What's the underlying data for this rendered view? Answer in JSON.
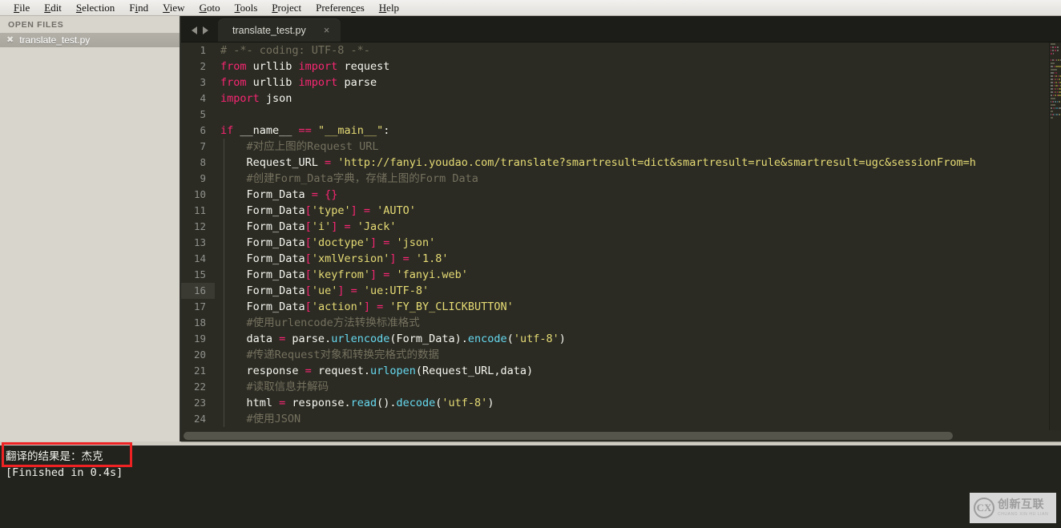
{
  "menubar": {
    "items": [
      {
        "label": "File",
        "acc_index": 0
      },
      {
        "label": "Edit",
        "acc_index": 0
      },
      {
        "label": "Selection",
        "acc_index": 0
      },
      {
        "label": "Find",
        "acc_index": 1
      },
      {
        "label": "View",
        "acc_index": 0
      },
      {
        "label": "Goto",
        "acc_index": 0
      },
      {
        "label": "Tools",
        "acc_index": 0
      },
      {
        "label": "Project",
        "acc_index": 0
      },
      {
        "label": "Preferences",
        "acc_index": 8
      },
      {
        "label": "Help",
        "acc_index": 0
      }
    ]
  },
  "sidebar": {
    "header": "OPEN FILES",
    "close_glyph": "✖",
    "files": [
      {
        "name": "translate_test.py",
        "selected": true
      }
    ]
  },
  "tabbar": {
    "nav_back": "◀",
    "nav_forward": "▶",
    "tabs": [
      {
        "label": "translate_test.py",
        "close": "×",
        "active": true
      }
    ]
  },
  "editor": {
    "active_line": 16,
    "lines": [
      {
        "num": "1",
        "indent": false,
        "tokens": [
          {
            "t": "com",
            "s": "# -*- coding: UTF-8 -*-"
          }
        ]
      },
      {
        "num": "2",
        "indent": false,
        "tokens": [
          {
            "t": "kw",
            "s": "from"
          },
          {
            "t": "id",
            "s": " urllib "
          },
          {
            "t": "kw",
            "s": "import"
          },
          {
            "t": "id",
            "s": " request"
          }
        ]
      },
      {
        "num": "3",
        "indent": false,
        "tokens": [
          {
            "t": "kw",
            "s": "from"
          },
          {
            "t": "id",
            "s": " urllib "
          },
          {
            "t": "kw",
            "s": "import"
          },
          {
            "t": "id",
            "s": " parse"
          }
        ]
      },
      {
        "num": "4",
        "indent": false,
        "tokens": [
          {
            "t": "kw",
            "s": "import"
          },
          {
            "t": "id",
            "s": " json"
          }
        ]
      },
      {
        "num": "5",
        "indent": false,
        "tokens": []
      },
      {
        "num": "6",
        "indent": false,
        "tokens": [
          {
            "t": "kw",
            "s": "if"
          },
          {
            "t": "id",
            "s": " __name__ "
          },
          {
            "t": "op",
            "s": "=="
          },
          {
            "t": "id",
            "s": " "
          },
          {
            "t": "str",
            "s": "\"__main__\""
          },
          {
            "t": "id",
            "s": ":"
          }
        ]
      },
      {
        "num": "7",
        "indent": true,
        "tokens": [
          {
            "t": "com",
            "s": "    #对应上图的Request URL"
          }
        ]
      },
      {
        "num": "8",
        "indent": true,
        "tokens": [
          {
            "t": "id",
            "s": "    Request_URL "
          },
          {
            "t": "op",
            "s": "="
          },
          {
            "t": "str",
            "s": " 'http://fanyi.youdao.com/translate?smartresult=dict&smartresult=rule&smartresult=ugc&sessionFrom=h"
          }
        ]
      },
      {
        "num": "9",
        "indent": true,
        "tokens": [
          {
            "t": "com",
            "s": "    #创建Form_Data字典，存储上图的Form Data"
          }
        ]
      },
      {
        "num": "10",
        "indent": true,
        "tokens": [
          {
            "t": "id",
            "s": "    Form_Data "
          },
          {
            "t": "op",
            "s": "="
          },
          {
            "t": "op",
            "s": " {}"
          }
        ]
      },
      {
        "num": "11",
        "indent": true,
        "tokens": [
          {
            "t": "id",
            "s": "    Form_Data"
          },
          {
            "t": "op",
            "s": "["
          },
          {
            "t": "str",
            "s": "'type'"
          },
          {
            "t": "op",
            "s": "] = "
          },
          {
            "t": "str",
            "s": "'AUTO'"
          }
        ]
      },
      {
        "num": "12",
        "indent": true,
        "tokens": [
          {
            "t": "id",
            "s": "    Form_Data"
          },
          {
            "t": "op",
            "s": "["
          },
          {
            "t": "str",
            "s": "'i'"
          },
          {
            "t": "op",
            "s": "] = "
          },
          {
            "t": "str",
            "s": "'Jack'"
          }
        ]
      },
      {
        "num": "13",
        "indent": true,
        "tokens": [
          {
            "t": "id",
            "s": "    Form_Data"
          },
          {
            "t": "op",
            "s": "["
          },
          {
            "t": "str",
            "s": "'doctype'"
          },
          {
            "t": "op",
            "s": "] = "
          },
          {
            "t": "str",
            "s": "'json'"
          }
        ]
      },
      {
        "num": "14",
        "indent": true,
        "tokens": [
          {
            "t": "id",
            "s": "    Form_Data"
          },
          {
            "t": "op",
            "s": "["
          },
          {
            "t": "str",
            "s": "'xmlVersion'"
          },
          {
            "t": "op",
            "s": "] = "
          },
          {
            "t": "str",
            "s": "'1.8'"
          }
        ]
      },
      {
        "num": "15",
        "indent": true,
        "tokens": [
          {
            "t": "id",
            "s": "    Form_Data"
          },
          {
            "t": "op",
            "s": "["
          },
          {
            "t": "str",
            "s": "'keyfrom'"
          },
          {
            "t": "op",
            "s": "] = "
          },
          {
            "t": "str",
            "s": "'fanyi.web'"
          }
        ]
      },
      {
        "num": "16",
        "indent": true,
        "tokens": [
          {
            "t": "id",
            "s": "    Form_Data"
          },
          {
            "t": "op",
            "s": "["
          },
          {
            "t": "str",
            "s": "'ue'"
          },
          {
            "t": "op",
            "s": "] = "
          },
          {
            "t": "str",
            "s": "'ue:UTF-8'"
          }
        ]
      },
      {
        "num": "17",
        "indent": true,
        "tokens": [
          {
            "t": "id",
            "s": "    Form_Data"
          },
          {
            "t": "op",
            "s": "["
          },
          {
            "t": "str",
            "s": "'action'"
          },
          {
            "t": "op",
            "s": "] = "
          },
          {
            "t": "str",
            "s": "'FY_BY_CLICKBUTTON'"
          }
        ]
      },
      {
        "num": "18",
        "indent": true,
        "tokens": [
          {
            "t": "com",
            "s": "    #使用urlencode方法转换标准格式"
          }
        ]
      },
      {
        "num": "19",
        "indent": true,
        "tokens": [
          {
            "t": "id",
            "s": "    data "
          },
          {
            "t": "op",
            "s": "="
          },
          {
            "t": "id",
            "s": " parse."
          },
          {
            "t": "fn",
            "s": "urlencode"
          },
          {
            "t": "id",
            "s": "(Form_Data)."
          },
          {
            "t": "fn",
            "s": "encode"
          },
          {
            "t": "id",
            "s": "("
          },
          {
            "t": "str",
            "s": "'utf-8'"
          },
          {
            "t": "id",
            "s": ")"
          }
        ]
      },
      {
        "num": "20",
        "indent": true,
        "tokens": [
          {
            "t": "com",
            "s": "    #传递Request对象和转换完格式的数据"
          }
        ]
      },
      {
        "num": "21",
        "indent": true,
        "tokens": [
          {
            "t": "id",
            "s": "    response "
          },
          {
            "t": "op",
            "s": "="
          },
          {
            "t": "id",
            "s": " request."
          },
          {
            "t": "fn",
            "s": "urlopen"
          },
          {
            "t": "id",
            "s": "(Request_URL,data)"
          }
        ]
      },
      {
        "num": "22",
        "indent": true,
        "tokens": [
          {
            "t": "com",
            "s": "    #读取信息并解码"
          }
        ]
      },
      {
        "num": "23",
        "indent": true,
        "tokens": [
          {
            "t": "id",
            "s": "    html "
          },
          {
            "t": "op",
            "s": "="
          },
          {
            "t": "id",
            "s": " response."
          },
          {
            "t": "fn",
            "s": "read"
          },
          {
            "t": "id",
            "s": "()."
          },
          {
            "t": "fn",
            "s": "decode"
          },
          {
            "t": "id",
            "s": "("
          },
          {
            "t": "str",
            "s": "'utf-8'"
          },
          {
            "t": "id",
            "s": ")"
          }
        ]
      },
      {
        "num": "24",
        "indent": true,
        "tokens": [
          {
            "t": "com",
            "s": "    #使用JSON"
          }
        ]
      }
    ]
  },
  "console": {
    "output": "翻译的结果是：杰克",
    "status": "[Finished in 0.4s]"
  },
  "annotation": {
    "color": "#ee2222"
  },
  "watermark": {
    "logo": "✖",
    "cn": "创新互联",
    "pinyin": "CHUANG XIN HU LIAN"
  },
  "colors": {
    "editor_bg": "#2b2b24",
    "keyword": "#f92672",
    "string": "#e6db74",
    "comment": "#75715e",
    "function": "#66d9ef",
    "identifier": "#f8f8f2"
  }
}
